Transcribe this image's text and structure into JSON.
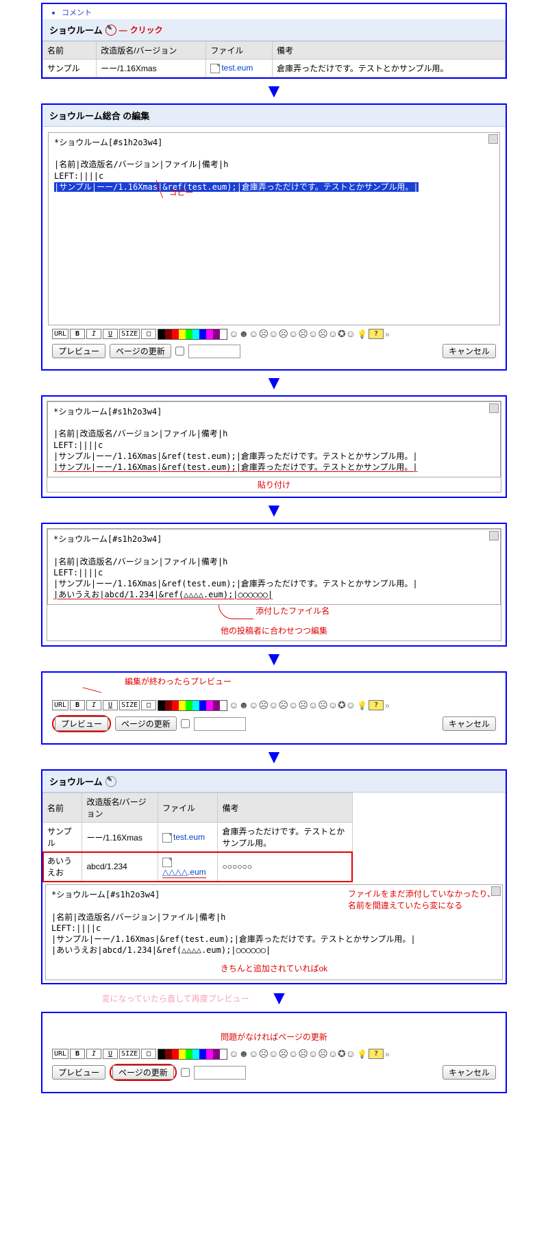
{
  "clickAnno": "クリック",
  "copyAnno": "コピー",
  "pasteAnno": "貼り付け",
  "attachAnno": "添付したファイル名",
  "editOtherAnno": "他の投稿者に合わせつつ編集",
  "previewAnno": "編集が終わったらプレビュー",
  "fileMissAnno1": "ファイルをまだ添付していなかったり、",
  "fileMissAnno2": "名前を間違えていたら変になる",
  "okAnno": "きちんと追加されていればok",
  "reprevAnno": "変になっていたら直して再度プレビュー",
  "updateAnno": "問題がなければページの更新",
  "commentLabel": "コメント",
  "showroom": "ショウルーム",
  "showroomEdit": "ショウルーム総合 の編集",
  "th": {
    "name": "名前",
    "ver": "改造版名/バージョン",
    "file": "ファイル",
    "note": "備考"
  },
  "row1": {
    "name": "サンプル",
    "ver": "ーー/1.16Xmas",
    "file": "test.eum",
    "note": "倉庫弄っただけです。テストとかサンプル用。"
  },
  "row2": {
    "name": "あいうえお",
    "ver": "abcd/1.234",
    "file": "△△△△.eum",
    "note": "○○○○○○"
  },
  "heading": "*ショウルーム[#s1h2o3w4]",
  "line1": "|名前|改造版名/バージョン|ファイル|備考|h",
  "line2": "LEFT:||||c",
  "line3": "|サンプル|ーー/1.16Xmas|&ref(test.eum);|倉庫弄っただけです。テストとかサンプル用。|",
  "line4": "|あいうえお|abcd/1.234|&ref(△△△△.eum);|○○○○○○|",
  "tb": {
    "url": "URL",
    "b": "B",
    "i": "I",
    "u": "U",
    "size": "SIZE",
    "att": "□",
    "help": "?",
    "raq": "»"
  },
  "btn": {
    "preview": "プレビュー",
    "update": "ページの更新",
    "cancel": "キャンセル"
  }
}
